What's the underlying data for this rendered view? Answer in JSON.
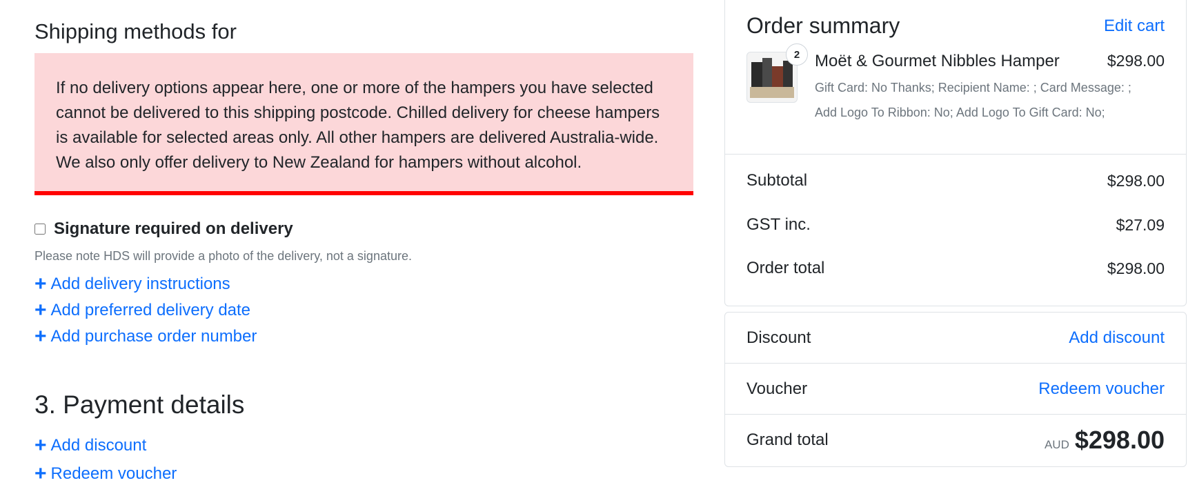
{
  "shipping": {
    "heading": "Shipping methods for",
    "alert": "If no delivery options appear here, one or more of the hampers you have selected cannot be delivered to this shipping postcode. Chilled delivery for cheese hampers is available for selected areas only. All other hampers are delivered Australia-wide. We also only offer delivery to New Zealand for hampers without alcohol.",
    "signature_label": "Signature required on delivery",
    "signature_note": "Please note HDS will provide a photo of the delivery, not a signature.",
    "links": [
      "Add delivery instructions",
      "Add preferred delivery date",
      "Add purchase order number"
    ]
  },
  "payment": {
    "heading": "3. Payment details",
    "links": [
      "Add discount",
      "Redeem voucher"
    ]
  },
  "summary": {
    "title": "Order summary",
    "edit_label": "Edit cart",
    "item": {
      "quantity": "2",
      "name": "Moët & Gourmet Nibbles Hamper",
      "price": "$298.00",
      "options_line1": "Gift Card: No Thanks; Recipient Name: ; Card Message: ;",
      "options_line2": "Add Logo To Ribbon: No; Add Logo To Gift Card: No;"
    },
    "subtotal_label": "Subtotal",
    "subtotal_value": "$298.00",
    "gst_label": "GST inc.",
    "gst_value": "$27.09",
    "order_total_label": "Order total",
    "order_total_value": "$298.00"
  },
  "extras": {
    "discount_label": "Discount",
    "discount_link": "Add discount",
    "voucher_label": "Voucher",
    "voucher_link": "Redeem voucher",
    "grand_total_label": "Grand total",
    "currency": "AUD",
    "grand_total_value": "$298.00"
  },
  "colors": {
    "link": "#0d6efd",
    "alert_bg": "#fcd7d9",
    "alert_border": "#ff0000"
  }
}
